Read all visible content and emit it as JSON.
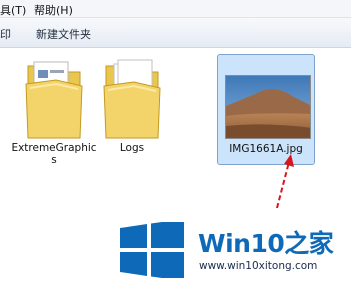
{
  "menu": {
    "items": [
      "具(T)",
      "帮助(H)"
    ]
  },
  "toolbar": {
    "left_label": "印",
    "new_folder_label": "新建文件夹"
  },
  "files": [
    {
      "name_line1": "ExtremeGraphic",
      "name_line2": "s",
      "kind": "folder-icon"
    },
    {
      "name_line1": "Logs",
      "kind": "folder-icon"
    },
    {
      "name_line1": "IMG1661A.jpg",
      "kind": "image-thumbnail"
    }
  ],
  "watermark": {
    "brand_latin": "Win10",
    "brand_zh": "之家",
    "site": "www.win10xitong.com",
    "brand_color": "#0e6ab8"
  },
  "colors": {
    "selection_bg": "#cce4fb",
    "selection_border": "#7da2ce",
    "annotation_arrow": "#d8141c"
  }
}
